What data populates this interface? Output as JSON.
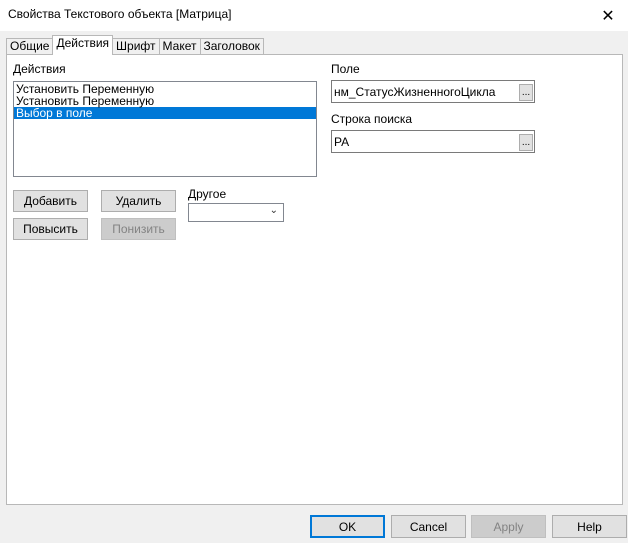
{
  "window": {
    "title": "Свойства Текстового объекта [Матрица]",
    "close_glyph": "✕"
  },
  "tabs": [
    {
      "label": "Общие",
      "active": false
    },
    {
      "label": "Действия",
      "active": true
    },
    {
      "label": "Шрифт",
      "active": false
    },
    {
      "label": "Макет",
      "active": false
    },
    {
      "label": "Заголовок",
      "active": false
    }
  ],
  "actions": {
    "label": "Действия",
    "items": [
      {
        "label": "Установить Переменную",
        "selected": false
      },
      {
        "label": "Установить Переменную",
        "selected": false
      },
      {
        "label": "Выбор в поле",
        "selected": true
      }
    ],
    "add_label": "Добавить",
    "delete_label": "Удалить",
    "promote_label": "Повысить",
    "demote_label": "Понизить",
    "other_label": "Другое",
    "other_value": ""
  },
  "field": {
    "label": "Поле",
    "value": "нм_СтатусЖизненногоЦикла",
    "browse": "..."
  },
  "search": {
    "label": "Строка поиска",
    "value": "PA",
    "browse": "..."
  },
  "footer": {
    "ok": "OK",
    "cancel": "Cancel",
    "apply": "Apply",
    "help": "Help"
  },
  "colors": {
    "selection": "#0078d7",
    "default_button_border": "#0078d7"
  }
}
